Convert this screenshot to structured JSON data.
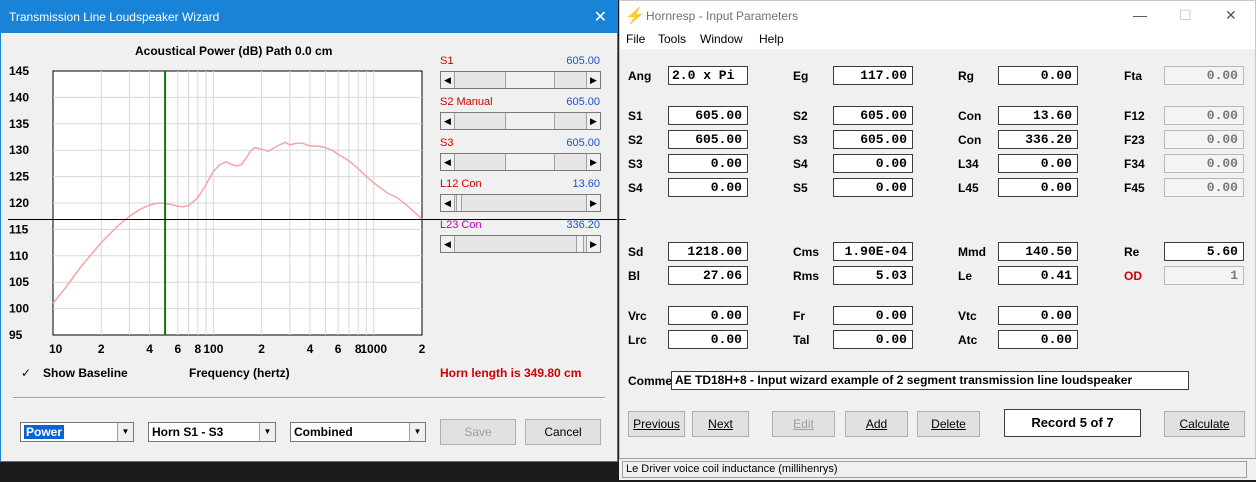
{
  "wizard": {
    "title": "Transmission Line Loudspeaker Wizard",
    "close_glyph": "✕",
    "plot_title": "Acoustical Power (dB)   Path 0.0 cm",
    "y_ticks": [
      "145",
      "140",
      "135",
      "130",
      "125",
      "120",
      "115",
      "110",
      "105",
      "100",
      "95"
    ],
    "x_ticks": [
      "10",
      "2",
      "4",
      "6",
      "8",
      "100",
      "2",
      "4",
      "6",
      "8",
      "1000",
      "2"
    ],
    "sliders": [
      {
        "label": "S1",
        "value": "605.00",
        "label_color": "#d00000",
        "thumb_fraction": 0.62
      },
      {
        "label": "S2  Manual",
        "value": "605.00",
        "label_color": "#d00000",
        "thumb_fraction": 0.62
      },
      {
        "label": "S3",
        "value": "605.00",
        "label_color": "#d00000",
        "thumb_fraction": 0.62
      },
      {
        "label": "L12  Con",
        "value": "13.60",
        "label_color": "#d00000",
        "thumb_fraction": 0.0
      },
      {
        "label": "L23  Con",
        "value": "336.20",
        "label_color": "#c000c0",
        "thumb_fraction": 0.9
      }
    ],
    "show_baseline_label": "Show Baseline",
    "show_baseline_checked": "✓",
    "frequency_label": "Frequency (hertz)",
    "horn_length": "Horn length is 349.80 cm",
    "combos": {
      "power": "Power",
      "horn": "Horn S1 - S3",
      "combined": "Combined"
    },
    "save_label": "Save",
    "cancel_label": "Cancel"
  },
  "chart_data": {
    "type": "line",
    "title": "Acoustical Power (dB)   Path 0.0 cm",
    "xlabel": "Frequency (hertz)",
    "ylabel": "",
    "xscale": "log",
    "xlim": [
      10,
      2000
    ],
    "ylim": [
      95,
      145
    ],
    "grid": true,
    "marker_x": 50,
    "series": [
      {
        "x": [
          10,
          12,
          15,
          20,
          25,
          30,
          35,
          40,
          45,
          50,
          55,
          60,
          65,
          70,
          80,
          90,
          100,
          110,
          120,
          130,
          140,
          150,
          160,
          170,
          180,
          200,
          220,
          250,
          280,
          300,
          330,
          360,
          400,
          450,
          500,
          550,
          600,
          700,
          800,
          900,
          1000,
          1200,
          1400,
          1600,
          1800,
          2000
        ],
        "y": [
          101,
          104,
          108,
          112.5,
          115.5,
          117.5,
          118.8,
          119.6,
          120,
          119.9,
          119.7,
          119.4,
          119.3,
          119.5,
          121,
          123.5,
          126,
          127.3,
          127.8,
          127.3,
          127,
          127.3,
          128.5,
          129.8,
          130.5,
          130.2,
          129.8,
          130.8,
          131.5,
          131,
          131.3,
          131.3,
          130.8,
          130.8,
          130.5,
          130,
          129.2,
          128,
          126.5,
          125,
          123.8,
          122,
          121,
          119.6,
          118.2,
          117
        ]
      }
    ]
  },
  "hornresp": {
    "title": "Hornresp - Input Parameters",
    "window_controls": {
      "minimize": "—",
      "maximize": "☐",
      "close": "✕"
    },
    "menu": [
      "File",
      "Tools",
      "Window",
      "Help"
    ],
    "params_top": [
      [
        "Ang",
        "2.0 x Pi",
        "Eg",
        "117.00",
        "Rg",
        "0.00",
        "Fta",
        "0.00"
      ],
      [
        "S1",
        "605.00",
        "S2",
        "605.00",
        "Con",
        "13.60",
        "F12",
        "0.00"
      ],
      [
        "S2",
        "605.00",
        "S3",
        "605.00",
        "Con",
        "336.20",
        "F23",
        "0.00"
      ],
      [
        "S3",
        "0.00",
        "S4",
        "0.00",
        "L34",
        "0.00",
        "F34",
        "0.00"
      ],
      [
        "S4",
        "0.00",
        "S5",
        "0.00",
        "L45",
        "0.00",
        "F45",
        "0.00"
      ]
    ],
    "params_driver": [
      [
        "Sd",
        "1218.00",
        "Cms",
        "1.90E-04",
        "Mmd",
        "140.50",
        "Re",
        "5.60"
      ],
      [
        "Bl",
        "27.06",
        "Rms",
        "5.03",
        "Le",
        "0.41",
        "OD",
        "1"
      ]
    ],
    "params_chamber": [
      [
        "Vrc",
        "0.00",
        "Fr",
        "0.00",
        "Vtc",
        "0.00"
      ],
      [
        "Lrc",
        "0.00",
        "Tal",
        "0.00",
        "Atc",
        "0.00"
      ]
    ],
    "comment_label": "Comment",
    "comment": "AE TD18H+8 - Input wizard example of 2 segment transmission line loudspeaker",
    "buttons": {
      "previous": "Previous",
      "next": "Next",
      "edit": "Edit",
      "add": "Add",
      "delete": "Delete",
      "calculate": "Calculate"
    },
    "record": "Record 5 of 7",
    "status": "Le   Driver voice coil inductance  (millihenrys)"
  }
}
